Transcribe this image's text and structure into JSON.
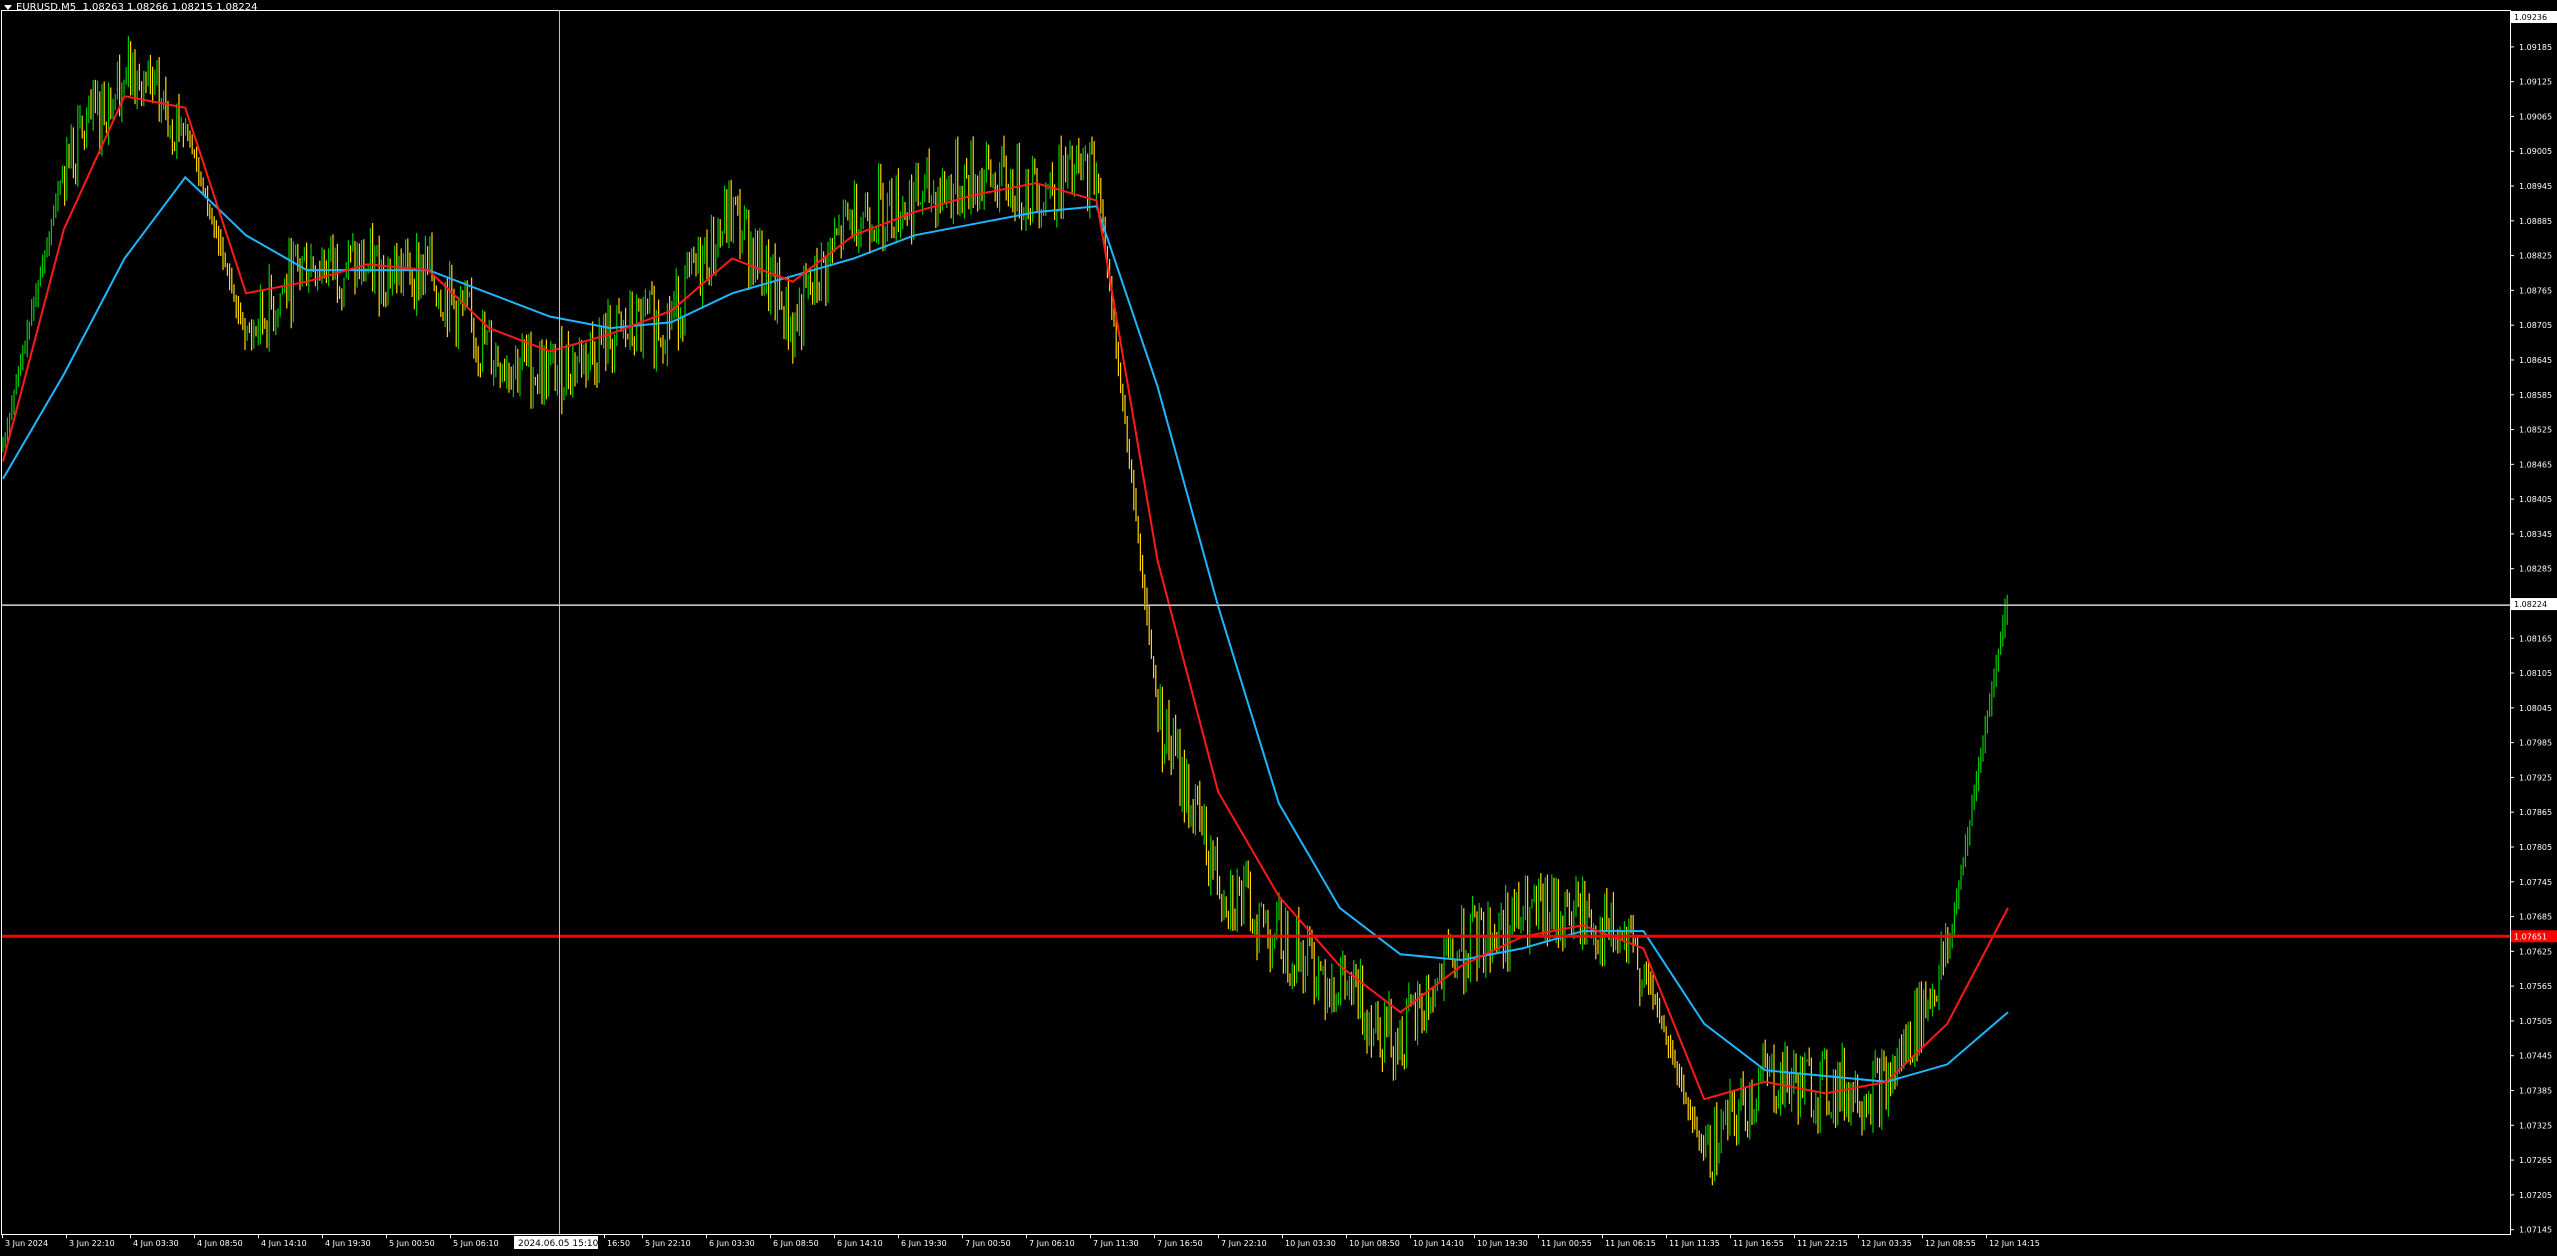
{
  "header": {
    "symbol_label": "EURUSD,M5",
    "ohlc_label": "1.08263 1.08266 1.08215 1.08224"
  },
  "colors": {
    "background": "#000000",
    "frame": "#ffffff",
    "candle_up": "#00c800",
    "candle_down": "#ffd400",
    "ma_fast": "#ff1a1a",
    "ma_slow": "#1fb6ff",
    "crosshair": "#c0c0c0",
    "level_line": "#ff0000"
  },
  "price_axis": {
    "top_value_label": "1.09236",
    "labels": [
      "1.09185",
      "1.09125",
      "1.09065",
      "1.09005",
      "1.08945",
      "1.08885",
      "1.08825",
      "1.08765",
      "1.08705",
      "1.08645",
      "1.08585",
      "1.08525",
      "1.08465",
      "1.08405",
      "1.08345",
      "1.08285",
      "1.08165",
      "1.08105",
      "1.08045",
      "1.07985",
      "1.07925",
      "1.07865",
      "1.07805",
      "1.07745",
      "1.07685",
      "1.07625",
      "1.07565",
      "1.07505",
      "1.07445",
      "1.07385",
      "1.07325",
      "1.07265",
      "1.07205",
      "1.07145"
    ],
    "current_price_label": "1.08224",
    "level_price_label": "1.07651",
    "ylim": [
      1.0714,
      1.0925
    ]
  },
  "time_axis": {
    "labels": [
      "3 Jun 2024",
      "3 Jun 22:10",
      "4 Jun 03:30",
      "4 Jun 08:50",
      "4 Jun 14:10",
      "4 Jun 19:30",
      "5 Jun 00:50",
      "5 Jun 06:10",
      "16:50",
      "5 Jun 22:10",
      "6 Jun 03:30",
      "6 Jun 08:50",
      "6 Jun 14:10",
      "6 Jun 19:30",
      "7 Jun 00:50",
      "7 Jun 06:10",
      "7 Jun 11:30",
      "7 Jun 16:50",
      "7 Jun 22:10",
      "10 Jun 03:30",
      "10 Jun 08:50",
      "10 Jun 14:10",
      "10 Jun 19:30",
      "11 Jun 00:55",
      "11 Jun 06:15",
      "11 Jun 11:35",
      "11 Jun 16:55",
      "11 Jun 22:15",
      "12 Jun 03:35",
      "12 Jun 08:55",
      "12 Jun 14:15"
    ],
    "crosshair_time_label": "2024.06.05 15:10"
  },
  "chart_data": {
    "type": "line",
    "title": "EURUSD,M5",
    "series": [
      {
        "name": "price",
        "x": [
          "3 Jun 2024",
          "3 Jun 22:10",
          "4 Jun 03:30",
          "4 Jun 08:50",
          "4 Jun 14:10",
          "4 Jun 19:30",
          "5 Jun 00:50",
          "5 Jun 06:10",
          "5 Jun 11:30",
          "5 Jun 16:50",
          "5 Jun 22:10",
          "6 Jun 03:30",
          "6 Jun 08:50",
          "6 Jun 14:10",
          "6 Jun 19:30",
          "7 Jun 00:50",
          "7 Jun 06:10",
          "7 Jun 11:30",
          "7 Jun 13:20",
          "7 Jun 16:50",
          "7 Jun 22:10",
          "10 Jun 03:30",
          "10 Jun 08:50",
          "10 Jun 14:10",
          "10 Jun 19:30",
          "11 Jun 00:55",
          "11 Jun 06:15",
          "11 Jun 11:35",
          "11 Jun 16:55",
          "11 Jun 22:15",
          "12 Jun 03:35",
          "12 Jun 08:55",
          "12 Jun 14:15",
          "12 Jun 14:50"
        ],
        "values": [
          1.085,
          1.0898,
          1.0914,
          1.0905,
          1.0868,
          1.0882,
          1.088,
          1.088,
          1.0866,
          1.0862,
          1.0868,
          1.0872,
          1.089,
          1.087,
          1.089,
          1.0892,
          1.0896,
          1.0894,
          1.0897,
          1.0804,
          1.0775,
          1.0765,
          1.0757,
          1.0747,
          1.0763,
          1.0768,
          1.0769,
          1.076,
          1.0727,
          1.0741,
          1.0739,
          1.0739,
          1.0762,
          1.0824
        ]
      },
      {
        "name": "ma_fast",
        "values": [
          1.0847,
          1.0887,
          1.091,
          1.0908,
          1.0876,
          1.0878,
          1.0881,
          1.088,
          1.087,
          1.0866,
          1.0869,
          1.0873,
          1.0882,
          1.0878,
          1.0886,
          1.089,
          1.0893,
          1.0895,
          1.0892,
          1.083,
          1.079,
          1.0772,
          1.076,
          1.0752,
          1.076,
          1.0765,
          1.0767,
          1.0763,
          1.0737,
          1.074,
          1.0738,
          1.074,
          1.075,
          1.077
        ]
      },
      {
        "name": "ma_slow",
        "values": [
          1.0844,
          1.0862,
          1.0882,
          1.0896,
          1.0886,
          1.088,
          1.088,
          1.088,
          1.0876,
          1.0872,
          1.087,
          1.0871,
          1.0876,
          1.0879,
          1.0882,
          1.0886,
          1.0888,
          1.089,
          1.0891,
          1.086,
          1.0822,
          1.0788,
          1.077,
          1.0762,
          1.0761,
          1.0763,
          1.0766,
          1.0766,
          1.075,
          1.0742,
          1.0741,
          1.074,
          1.0743,
          1.0752
        ]
      }
    ],
    "ylim": [
      1.0714,
      1.0925
    ],
    "current_price": 1.08224,
    "horizontal_level": 1.07651,
    "crosshair_time": "2024.06.05 15:10",
    "grid": false
  }
}
